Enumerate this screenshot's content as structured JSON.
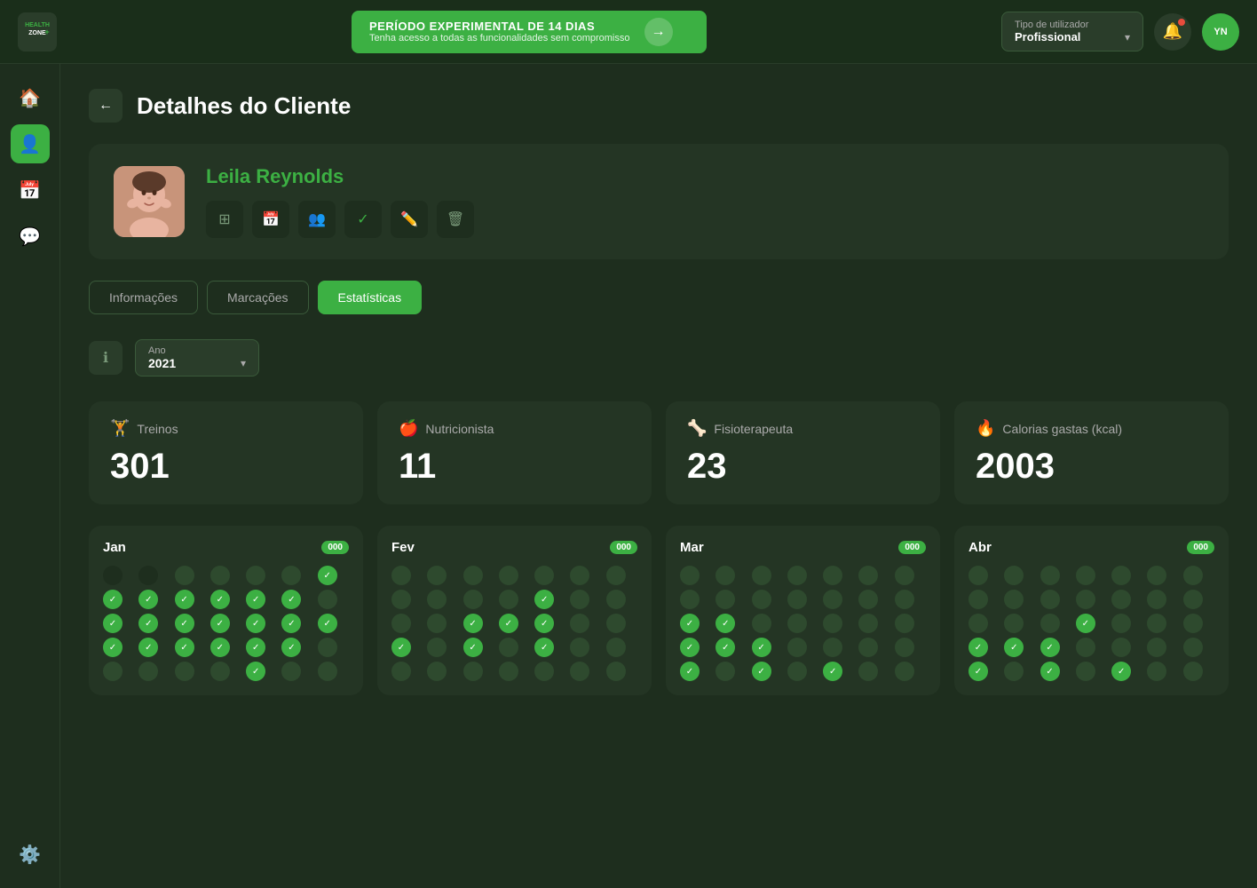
{
  "topbar": {
    "logo_text": "HEALTH ZONE+",
    "trial_title": "PERÍODO EXPERIMENTAL DE 14 DIAS",
    "trial_sub": "Tenha acesso a todas as funcionalidades sem compromisso",
    "user_type_label": "Tipo de utilizador",
    "user_type_value": "Profissional",
    "avatar_initials": "YN"
  },
  "sidebar": {
    "items": [
      {
        "icon": "🏠",
        "label": "home",
        "active": false
      },
      {
        "icon": "👤",
        "label": "clients",
        "active": true
      },
      {
        "icon": "📅",
        "label": "schedule",
        "active": false
      },
      {
        "icon": "💬",
        "label": "messages",
        "active": false
      },
      {
        "icon": "⚙️",
        "label": "settings",
        "active": false
      }
    ]
  },
  "page": {
    "title": "Detalhes do Cliente",
    "back_label": "←"
  },
  "client": {
    "name": "Leila Reynolds",
    "actions": [
      {
        "icon": "⊞",
        "label": "share"
      },
      {
        "icon": "📅",
        "label": "calendar"
      },
      {
        "icon": "👥",
        "label": "associate"
      },
      {
        "icon": "✓",
        "label": "activate"
      },
      {
        "icon": "✏️",
        "label": "edit"
      },
      {
        "icon": "🗑",
        "label": "delete"
      }
    ]
  },
  "tabs": [
    {
      "label": "Informações",
      "active": false
    },
    {
      "label": "Marcações",
      "active": false
    },
    {
      "label": "Estatísticas",
      "active": true
    }
  ],
  "filter": {
    "year_label": "Ano",
    "year_value": "2021"
  },
  "stats": [
    {
      "icon": "🏋",
      "label": "Treinos",
      "value": "301"
    },
    {
      "icon": "🍎",
      "label": "Nutricionista",
      "value": "11"
    },
    {
      "icon": "🦴",
      "label": "Fisioterapeuta",
      "value": "23"
    },
    {
      "icon": "🔥",
      "label": "Calorias gastas (kcal)",
      "value": "2003"
    }
  ],
  "months": [
    {
      "name": "Jan",
      "badge": "000",
      "dots": [
        "dark",
        "dark",
        "medium",
        "medium",
        "medium",
        "medium",
        "checked",
        "checked",
        "checked",
        "checked",
        "checked",
        "checked",
        "checked",
        "medium",
        "checked",
        "checked",
        "checked",
        "checked",
        "checked",
        "checked",
        "checked",
        "checked",
        "checked",
        "checked",
        "checked",
        "checked",
        "checked",
        "medium",
        "medium",
        "medium",
        "medium",
        "medium",
        "checked",
        "medium",
        "medium"
      ]
    },
    {
      "name": "Fev",
      "badge": "000",
      "dots": [
        "medium",
        "medium",
        "medium",
        "medium",
        "medium",
        "medium",
        "medium",
        "medium",
        "medium",
        "medium",
        "medium",
        "checked",
        "medium",
        "medium",
        "medium",
        "medium",
        "checked",
        "checked",
        "checked",
        "medium",
        "medium",
        "checked",
        "medium",
        "checked",
        "medium",
        "checked",
        "medium",
        "medium",
        "medium",
        "medium",
        "medium",
        "medium",
        "medium",
        "medium",
        "medium"
      ]
    },
    {
      "name": "Mar",
      "badge": "000",
      "dots": [
        "medium",
        "medium",
        "medium",
        "medium",
        "medium",
        "medium",
        "medium",
        "medium",
        "medium",
        "medium",
        "medium",
        "medium",
        "medium",
        "medium",
        "checked",
        "checked",
        "medium",
        "medium",
        "medium",
        "medium",
        "medium",
        "checked",
        "checked",
        "checked",
        "medium",
        "medium",
        "medium",
        "medium",
        "checked",
        "medium",
        "checked",
        "medium",
        "checked",
        "medium",
        "medium"
      ]
    },
    {
      "name": "Abr",
      "badge": "000",
      "dots": [
        "medium",
        "medium",
        "medium",
        "medium",
        "medium",
        "medium",
        "medium",
        "medium",
        "medium",
        "medium",
        "medium",
        "medium",
        "medium",
        "medium",
        "medium",
        "medium",
        "medium",
        "checked",
        "medium",
        "medium",
        "medium",
        "checked",
        "checked",
        "checked",
        "medium",
        "medium",
        "medium",
        "medium",
        "checked",
        "medium",
        "checked",
        "medium",
        "checked",
        "medium",
        "medium"
      ]
    }
  ]
}
